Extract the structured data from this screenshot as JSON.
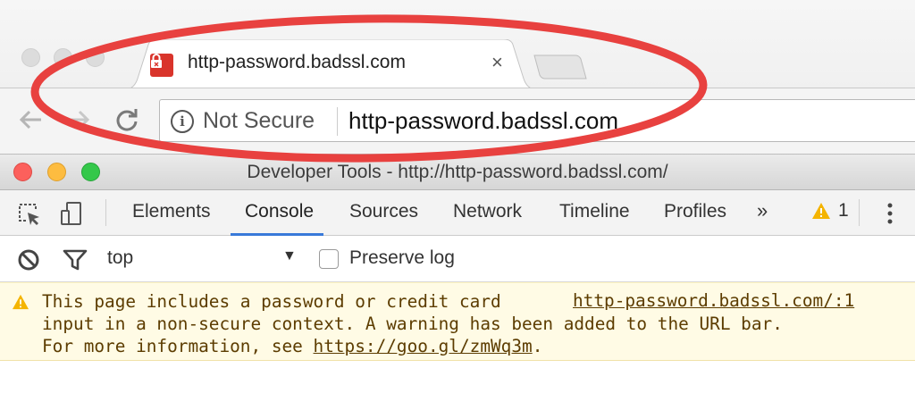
{
  "browser": {
    "tab": {
      "title": "http-password.badssl.com",
      "close_glyph": "×",
      "favicon": "lock-icon"
    },
    "omnibox": {
      "security_label": "Not Secure",
      "url": "http-password.badssl.com",
      "security_icon": "info-icon"
    },
    "nav_icons": [
      "back-arrow-icon",
      "forward-arrow-icon",
      "reload-icon"
    ]
  },
  "devtools": {
    "window_title": "Developer Tools - http://http-password.badssl.com/",
    "tabs": [
      {
        "label": "Elements",
        "active": false
      },
      {
        "label": "Console",
        "active": true
      },
      {
        "label": "Sources",
        "active": false
      },
      {
        "label": "Network",
        "active": false
      },
      {
        "label": "Timeline",
        "active": false
      },
      {
        "label": "Profiles",
        "active": false
      }
    ],
    "more_tabs": "»",
    "warning_count": "1",
    "console": {
      "context": "top",
      "preserve_log_label": "Preserve log",
      "preserve_log_checked": false,
      "warning": {
        "line1": "This page includes a password or credit card",
        "source": "http-password.badssl.com/:1",
        "line2": "input in a non-secure context. A warning has been added to the URL bar.",
        "line3_prefix": "For more information, see ",
        "link": "https://goo.gl/zmWq3m",
        "line3_suffix": "."
      }
    }
  },
  "colors": {
    "highlight_red": "#e8413f",
    "tab_active_underline": "#3879d9",
    "warning_bg": "#fffbe5",
    "warning_text": "#5c3c00",
    "warning_icon": "#f4b400",
    "favicon_red": "#d9342b",
    "mac_close": "#fc605c",
    "mac_minimize": "#fdbc40",
    "mac_zoom": "#34c84a"
  }
}
